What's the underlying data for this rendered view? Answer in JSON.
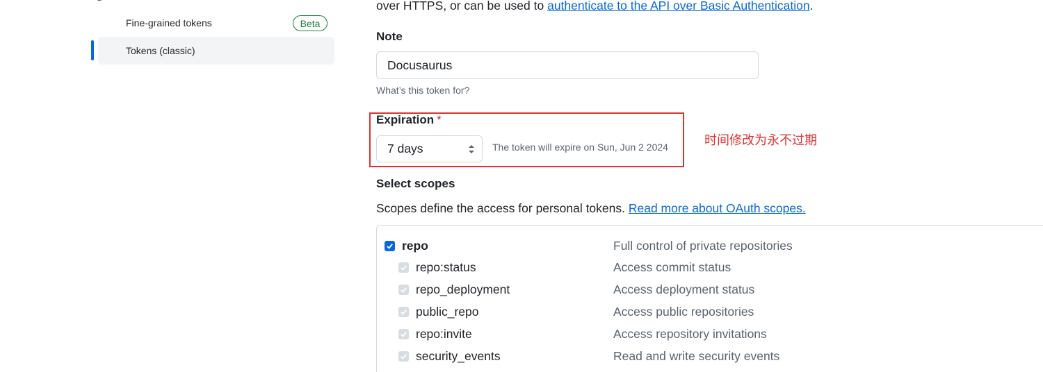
{
  "sidebar": {
    "items": [
      {
        "label": "Fine-grained tokens",
        "badge": "Beta"
      },
      {
        "label": "Tokens (classic)"
      }
    ]
  },
  "intro": {
    "prefix": "over HTTPS, or can be used to ",
    "link": "authenticate to the API over Basic Authentication",
    "suffix": "."
  },
  "note": {
    "label": "Note",
    "value": "Docusaurus",
    "hint": "What’s this token for?"
  },
  "expiration": {
    "label": "Expiration",
    "required_mark": "*",
    "selected": "7 days",
    "note": "The token will expire on Sun, Jun 2 2024"
  },
  "annotation": "时间修改为永不过期",
  "scopes": {
    "label": "Select scopes",
    "description": "Scopes define the access for personal tokens. ",
    "link": "Read more about OAuth scopes.",
    "items": [
      {
        "name": "repo",
        "desc": "Full control of private repositories",
        "checked": true,
        "primary": true
      },
      {
        "name": "repo:status",
        "desc": "Access commit status",
        "checked": true
      },
      {
        "name": "repo_deployment",
        "desc": "Access deployment status",
        "checked": true
      },
      {
        "name": "public_repo",
        "desc": "Access public repositories",
        "checked": true
      },
      {
        "name": "repo:invite",
        "desc": "Access repository invitations",
        "checked": true
      },
      {
        "name": "security_events",
        "desc": "Read and write security events",
        "checked": true
      }
    ]
  },
  "colors": {
    "accent": "#0969da",
    "success": "#1a7f37",
    "danger": "#d1242f",
    "annotation": "#e03131"
  }
}
